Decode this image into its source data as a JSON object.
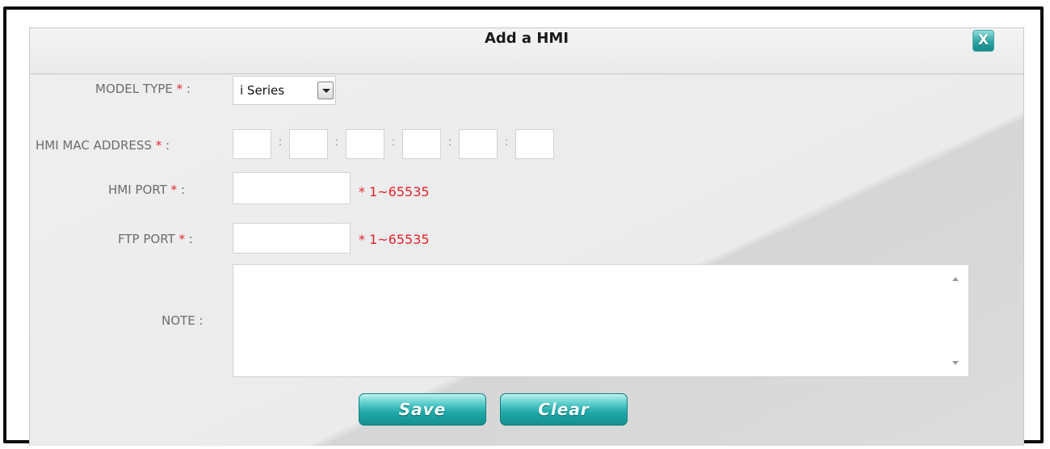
{
  "dialog": {
    "title": "Add a HMI",
    "close_label": "X"
  },
  "form": {
    "model_type": {
      "label": "MODEL TYPE",
      "required_mark": "*",
      "colon": ":",
      "selected": "i Series"
    },
    "mac_address": {
      "label": "HMI MAC ADDRESS",
      "required_mark": "*",
      "colon": ":",
      "separator": ":",
      "octets": [
        "",
        "",
        "",
        "",
        "",
        ""
      ]
    },
    "hmi_port": {
      "label": "HMI PORT",
      "required_mark": "*",
      "colon": ":",
      "value": "",
      "hint": "* 1~65535"
    },
    "ftp_port": {
      "label": "FTP PORT",
      "required_mark": "*",
      "colon": ":",
      "value": "",
      "hint": "* 1~65535"
    },
    "note": {
      "label": "NOTE",
      "colon": ":",
      "value": ""
    }
  },
  "buttons": {
    "save": "Save",
    "clear": "Clear"
  },
  "colors": {
    "required": "#e3232b",
    "button_teal": "#1fa8a8",
    "label_gray": "#6c6c6c"
  }
}
